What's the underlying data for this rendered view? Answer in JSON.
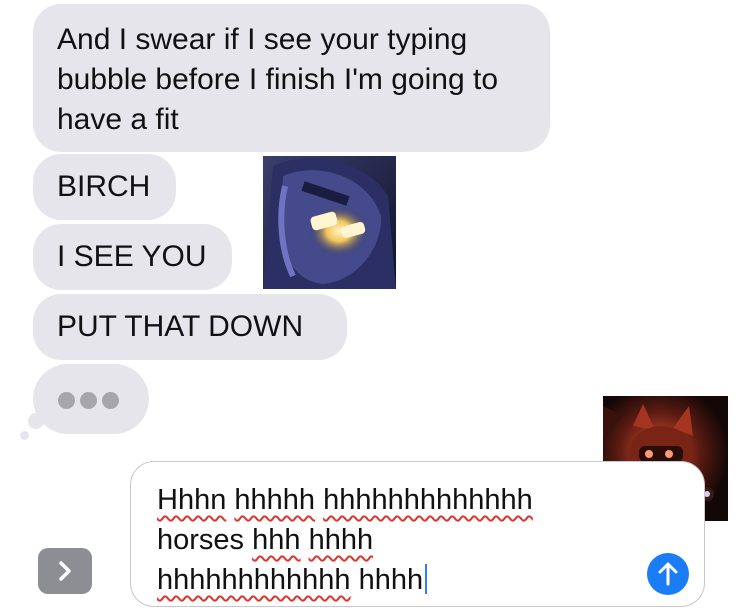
{
  "messages": [
    {
      "text": "And I swear if I see your typing bubble before I finish I'm going to have a fit"
    },
    {
      "text": "BIRCH"
    },
    {
      "text": "I SEE YOU"
    },
    {
      "text": "PUT THAT DOWN"
    }
  ],
  "typing_indicator": {
    "icon": "ellipsis-dots"
  },
  "stickers": [
    {
      "icon": "dark-blue-robot-character-sticker"
    },
    {
      "icon": "red-glowing-robot-character-sticker"
    }
  ],
  "compose": {
    "line1_word1": "Hhhn",
    "line1_word2": "hhhhh",
    "line1_word3": "hhhhhhhhhhhhh",
    "line2_word1": "horses",
    "line2_word2": "hhh",
    "line2_word3": "hhhh",
    "line3_word1": "hhhhhhhhhhhh",
    "line3_word2": "hhhh"
  },
  "buttons": {
    "apps_icon": "chevron-right",
    "send_icon": "arrow-up"
  },
  "colors": {
    "bubble": "#e6e5eb",
    "send": "#1b7df5",
    "spellcheck": "#e0342d"
  }
}
